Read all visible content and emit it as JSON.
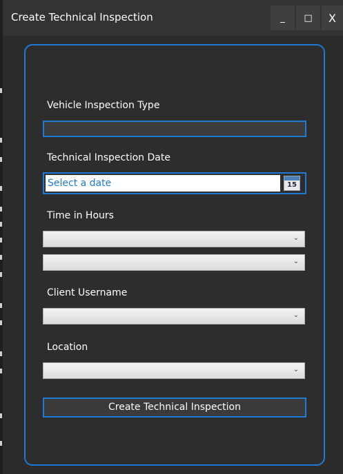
{
  "window": {
    "title": "Create Technical Inspection",
    "minimize_label": "_",
    "maximize_label": "□",
    "close_label": "X"
  },
  "form": {
    "vehicle_inspection_type_label": "Vehicle Inspection Type",
    "vehicle_inspection_type_value": "",
    "technical_inspection_date_label": "Technical Inspection Date",
    "date_placeholder": "Select a date",
    "calendar_day": "15",
    "time_in_hours_label": "Time in Hours",
    "hours_value": "",
    "minutes_value": "",
    "client_username_label": "Client Username",
    "client_username_value": "",
    "location_label": "Location",
    "location_value": "",
    "submit_label": "Create Technical Inspection"
  },
  "colors": {
    "accent": "#1e7ad6",
    "background": "#2d2d2d",
    "titlebar": "#333333"
  }
}
